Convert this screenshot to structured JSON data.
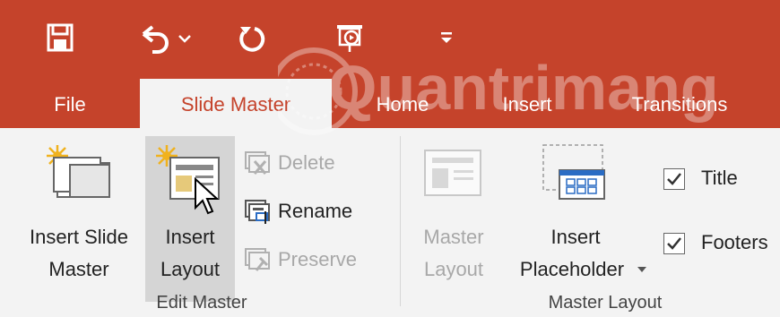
{
  "quick_access": {
    "save_icon": "save-icon",
    "undo_icon": "undo-icon",
    "redo_icon": "redo-icon",
    "start_from_beginning_icon": "start-from-beginning-icon",
    "customize_icon": "customize-quick-access-icon"
  },
  "tabs": [
    {
      "label": "File"
    },
    {
      "label": "Slide Master"
    },
    {
      "label": "Home"
    },
    {
      "label": "Insert"
    },
    {
      "label": "Transitions"
    }
  ],
  "edit_master": {
    "group_label": "Edit Master",
    "insert_slide_master": {
      "line1": "Insert Slide",
      "line2": "Master"
    },
    "insert_layout": {
      "line1": "Insert",
      "line2": "Layout"
    },
    "delete_label": "Delete",
    "rename_label": "Rename",
    "preserve_label": "Preserve"
  },
  "master_layout": {
    "group_label": "Master Layout",
    "master_layout_btn": {
      "line1": "Master",
      "line2": "Layout"
    },
    "insert_placeholder": {
      "line1": "Insert",
      "line2": "Placeholder"
    },
    "title_checkbox": {
      "label": "Title",
      "checked": true
    },
    "footers_checkbox": {
      "label": "Footers",
      "checked": true
    }
  },
  "watermark_text": "Quantrimang",
  "colors": {
    "accent": "#c5432b",
    "ribbon": "#f3f3f3",
    "dim_text": "#a8a8a8"
  }
}
